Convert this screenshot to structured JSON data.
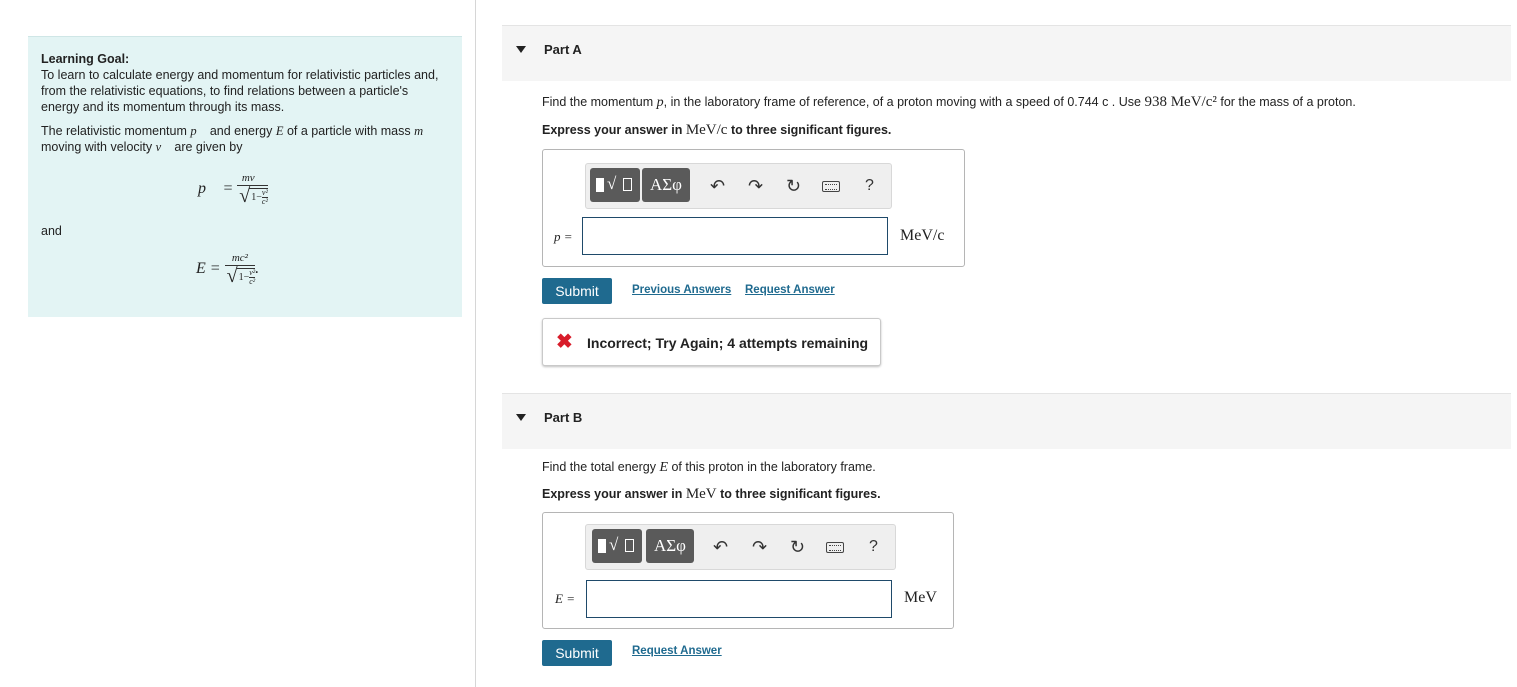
{
  "goal": {
    "title": "Learning Goal:",
    "text": "To learn to calculate energy and momentum for relativistic particles and, from the relativistic equations, to find relations between a particle's energy and its momentum through its mass.",
    "desc_1": "The relativistic momentum ",
    "desc_p": "p⃗",
    "desc_2": " and energy ",
    "desc_E": "E",
    "desc_3": " of a particle with mass ",
    "desc_m": "m",
    "desc_4": " moving with velocity ",
    "desc_v": "v⃗",
    "desc_5": " are given by",
    "and": "and",
    "p_lhs": "p⃗ =",
    "p_num": "mv⃗",
    "E_lhs": "E =",
    "E_num": "mc²",
    "sqrt_one": "1−",
    "sqrt_top": "v²",
    "sqrt_bot": "c²",
    "E_tail": "."
  },
  "partA": {
    "title": "Part A",
    "q1": "Find the momentum ",
    "q_sym": "p",
    "q2": ", in the laboratory frame of reference, of a proton moving with a speed of 0.744 c . Use ",
    "q_mass": "938 MeV/c²",
    "q3": " for the mass of a proton.",
    "instr1": "Express your answer in ",
    "instr_unit": "MeV/c",
    "instr2": " to three significant figures.",
    "var": "p =",
    "unit": "MeV/c",
    "input_value": "",
    "submit": "Submit",
    "previous": "Previous Answers",
    "request": "Request Answer",
    "feedback": "Incorrect; Try Again; 4 attempts remaining"
  },
  "partB": {
    "title": "Part B",
    "q1": "Find the total energy ",
    "q_sym": "E",
    "q2": " of this proton in the laboratory frame.",
    "instr1": "Express your answer in ",
    "instr_unit": "MeV",
    "instr2": " to three significant figures.",
    "var": "E =",
    "unit": "MeV",
    "input_value": "",
    "submit": "Submit",
    "request": "Request Answer"
  },
  "toolbar": {
    "greek": "ΑΣφ",
    "undo": "↶",
    "redo": "↷",
    "reset": "↻",
    "help": "?"
  },
  "colors": {
    "panel": "#e3f4f4",
    "accent": "#1f6a8f",
    "error": "#d81c2a"
  }
}
